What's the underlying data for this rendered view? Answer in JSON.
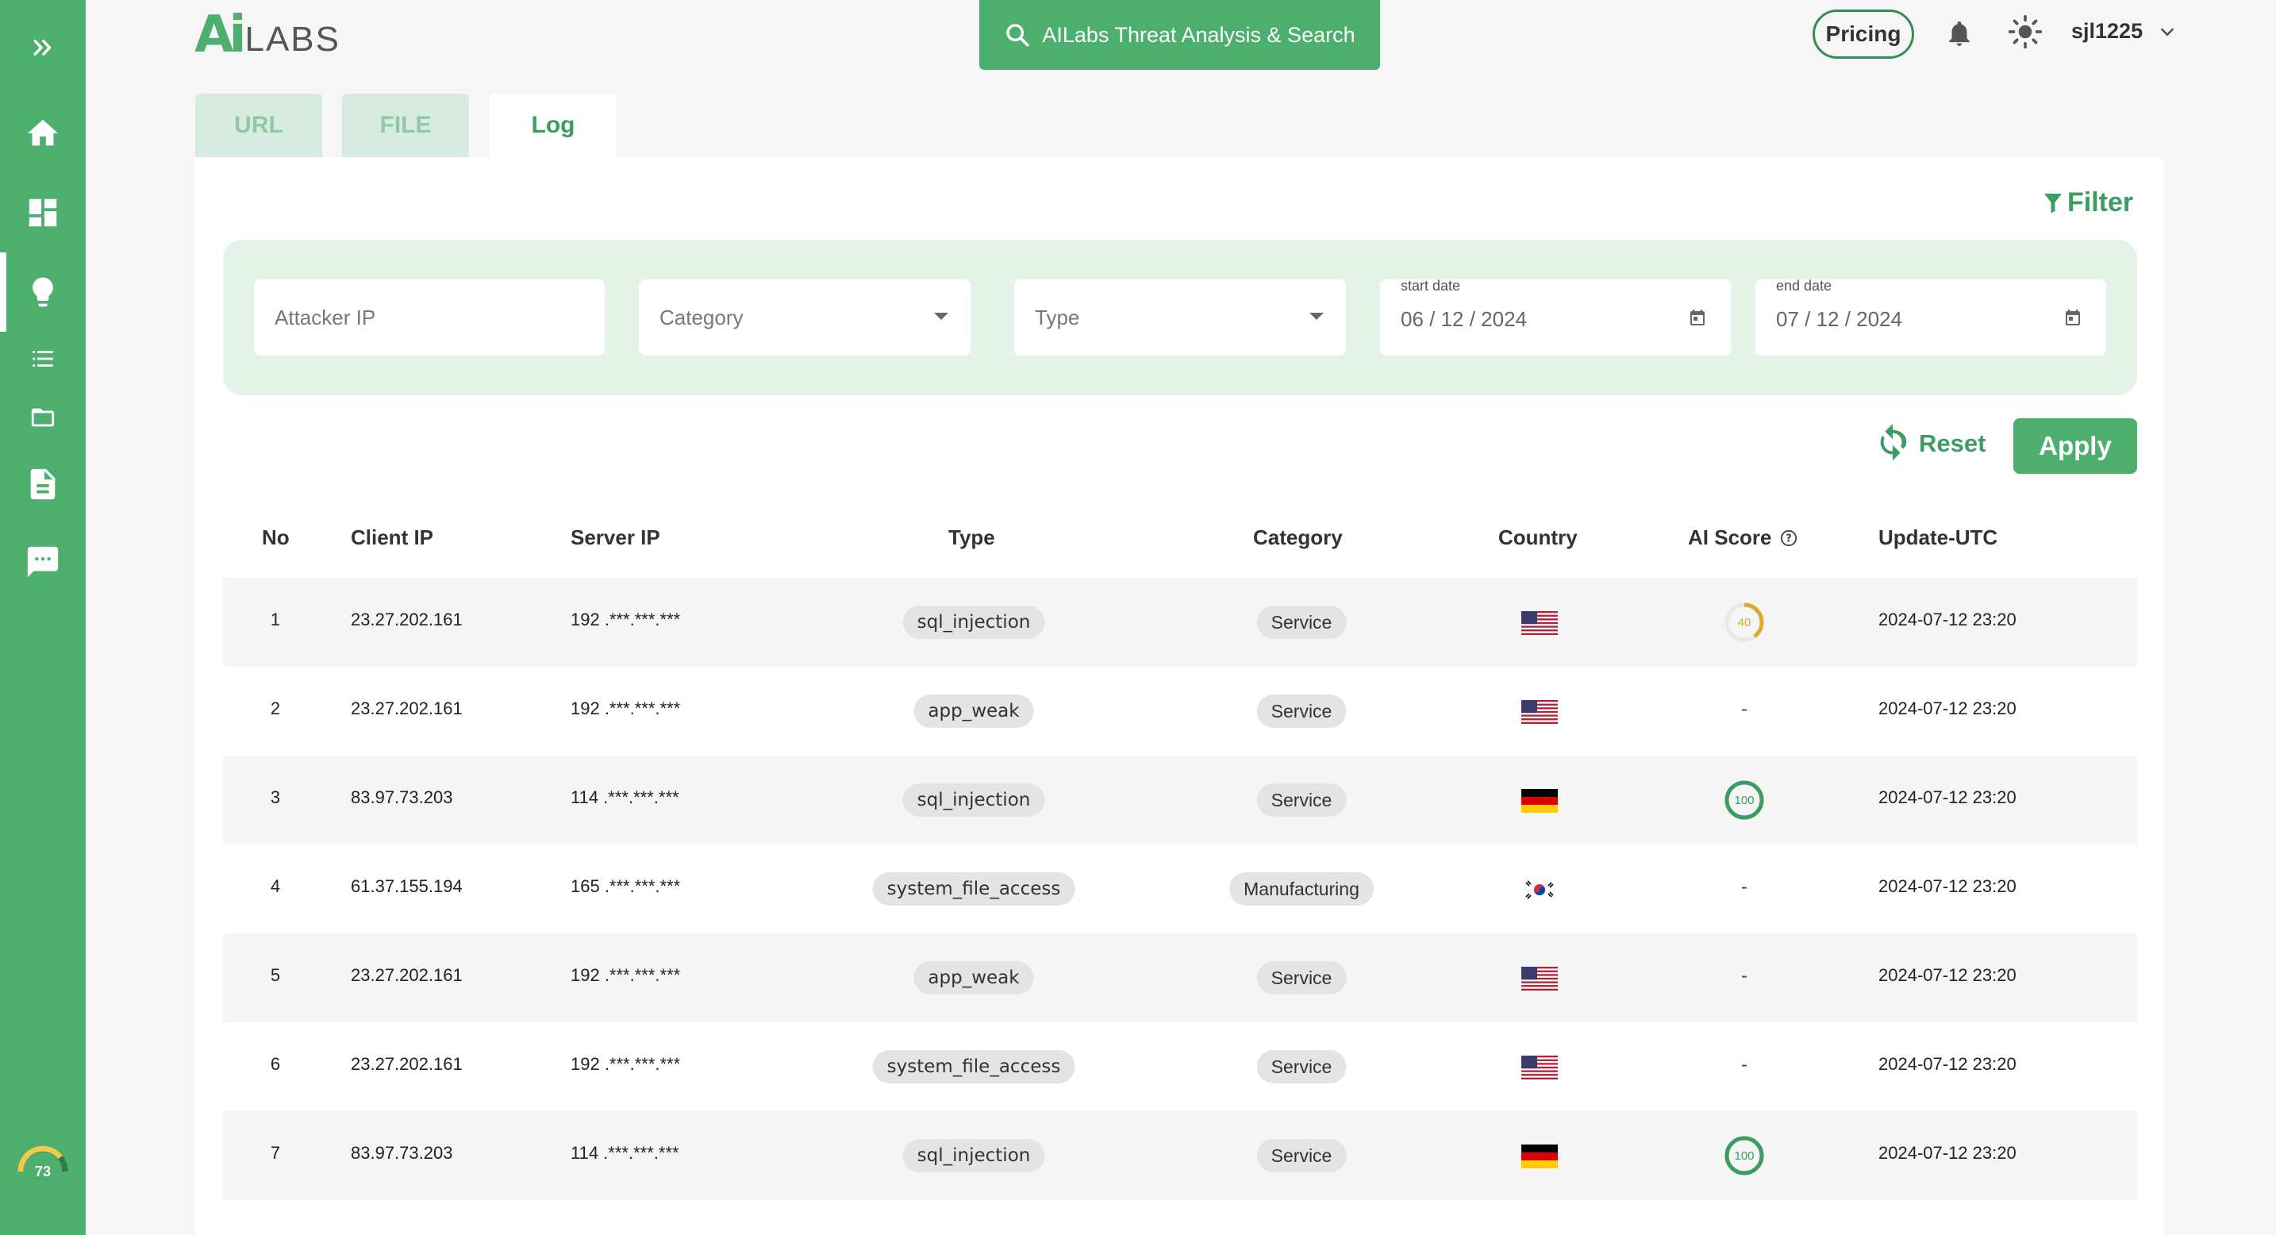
{
  "brand": {
    "logo_ai": "Ai",
    "logo_labs": "LABS"
  },
  "search": {
    "label": "AILabs Threat Analysis & Search"
  },
  "header": {
    "pricing": "Pricing",
    "username": "sjl1225"
  },
  "sidebar": {
    "items": [
      {
        "icon": "expand-icon"
      },
      {
        "icon": "home-icon"
      },
      {
        "icon": "dashboard-icon"
      },
      {
        "icon": "lightbulb-icon",
        "active": true
      },
      {
        "icon": "list-icon"
      },
      {
        "icon": "folder-icon"
      },
      {
        "icon": "document-icon"
      },
      {
        "icon": "chat-icon"
      }
    ],
    "gauge_value": "73"
  },
  "tabs": [
    {
      "label": "URL",
      "active": false
    },
    {
      "label": "FILE",
      "active": false
    },
    {
      "label": "Log",
      "active": true
    }
  ],
  "filter": {
    "toggle_label": "Filter",
    "attacker_ip_placeholder": "Attacker IP",
    "category_placeholder": "Category",
    "type_placeholder": "Type",
    "start_date_label": "start date",
    "start_date": "06 / 12 / 2024",
    "end_date_label": "end date",
    "end_date": "07 / 12 / 2024",
    "reset_label": "Reset",
    "apply_label": "Apply"
  },
  "table": {
    "columns": [
      "No",
      "Client IP",
      "Server IP",
      "Type",
      "Category",
      "Country",
      "AI Score",
      "Update-UTC"
    ],
    "rows": [
      {
        "no": "1",
        "client_ip": "23.27.202.161",
        "server_ip": "192 .***.***.***",
        "type": "sql_injection",
        "category": "Service",
        "country": "us",
        "score": "40",
        "score_fraction": 0.4,
        "updated": "2024-07-12 23:20"
      },
      {
        "no": "2",
        "client_ip": "23.27.202.161",
        "server_ip": "192 .***.***.***",
        "type": "app_weak",
        "category": "Service",
        "country": "us",
        "score": "-",
        "updated": "2024-07-12 23:20"
      },
      {
        "no": "3",
        "client_ip": "83.97.73.203",
        "server_ip": "114 .***.***.***",
        "type": "sql_injection",
        "category": "Service",
        "country": "de",
        "score": "100",
        "score_fraction": 1.0,
        "updated": "2024-07-12 23:20"
      },
      {
        "no": "4",
        "client_ip": "61.37.155.194",
        "server_ip": "165 .***.***.***",
        "type": "system_file_access",
        "category": "Manufacturing",
        "country": "kr",
        "score": "-",
        "updated": "2024-07-12 23:20"
      },
      {
        "no": "5",
        "client_ip": "23.27.202.161",
        "server_ip": "192 .***.***.***",
        "type": "app_weak",
        "category": "Service",
        "country": "us",
        "score": "-",
        "updated": "2024-07-12 23:20"
      },
      {
        "no": "6",
        "client_ip": "23.27.202.161",
        "server_ip": "192 .***.***.***",
        "type": "system_file_access",
        "category": "Service",
        "country": "us",
        "score": "-",
        "updated": "2024-07-12 23:20"
      },
      {
        "no": "7",
        "client_ip": "83.97.73.203",
        "server_ip": "114 .***.***.***",
        "type": "sql_injection",
        "category": "Service",
        "country": "de",
        "score": "100",
        "score_fraction": 1.0,
        "updated": "2024-07-12 23:20"
      }
    ]
  },
  "colors": {
    "brand_green": "#4caf6e",
    "score_low": "#e0a82e",
    "score_high": "#3a9d61"
  }
}
